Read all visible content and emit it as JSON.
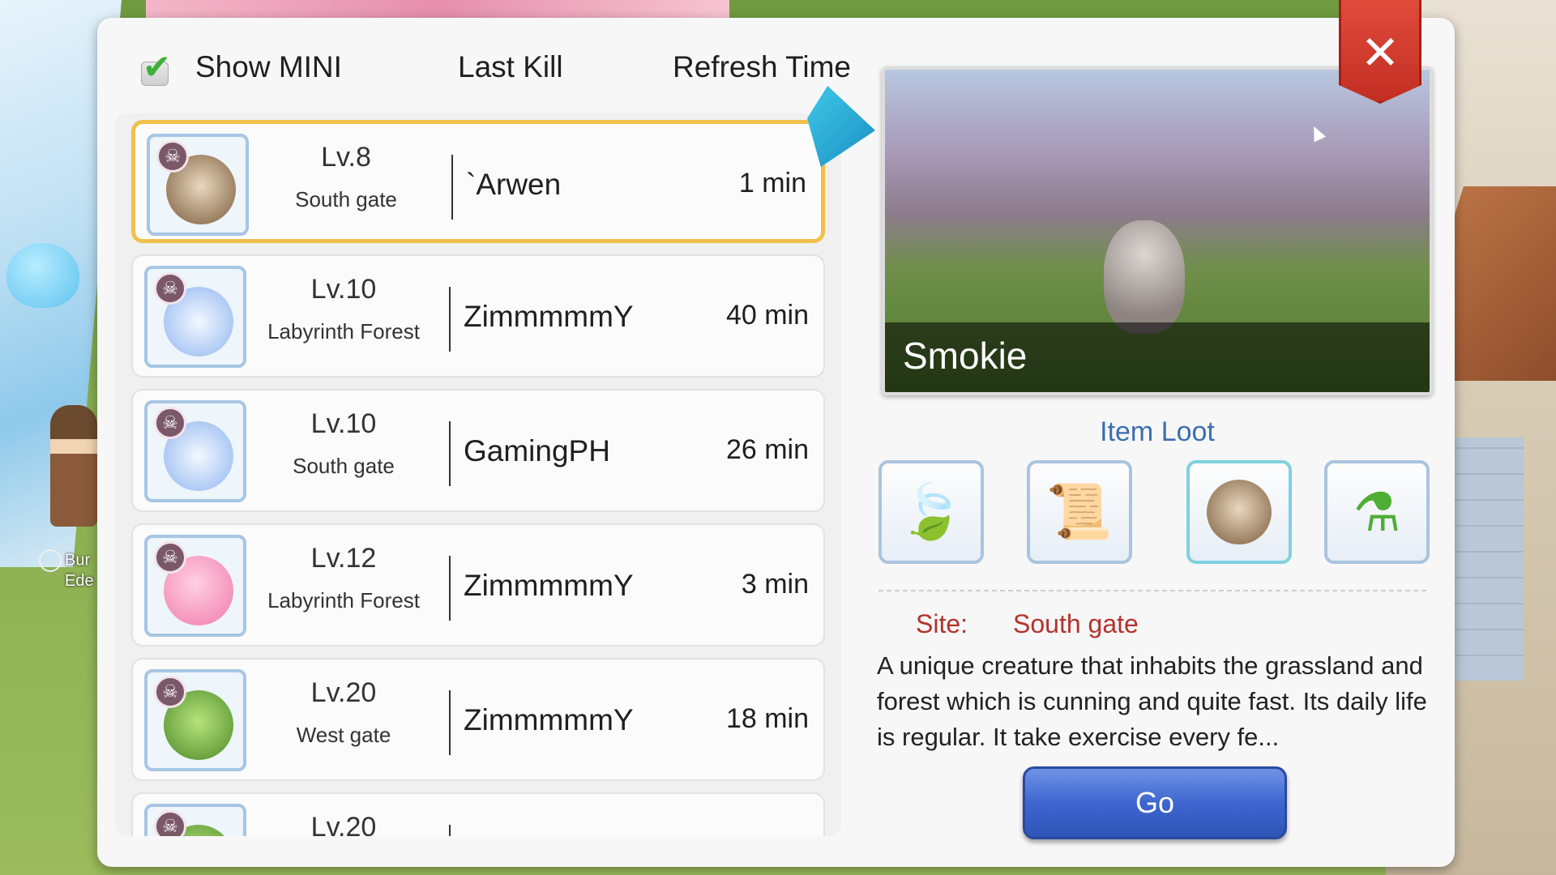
{
  "header": {
    "show_mini_label": "Show MINI",
    "show_mini_checked": true,
    "last_kill_label": "Last Kill",
    "refresh_time_label": "Refresh Time"
  },
  "rows": [
    {
      "level": "Lv.8",
      "site": "South gate",
      "last_kill": "`Arwen",
      "refresh": "1 min",
      "selected": true,
      "creature": "raccoon-icon"
    },
    {
      "level": "Lv.10",
      "site": "Labyrinth Forest",
      "last_kill": "ZimmmmmY",
      "refresh": "40 min",
      "selected": false,
      "creature": "lunatic-icon"
    },
    {
      "level": "Lv.10",
      "site": "South gate",
      "last_kill": "GamingPH",
      "refresh": "26 min",
      "selected": false,
      "creature": "lunatic-icon"
    },
    {
      "level": "Lv.12",
      "site": "Labyrinth Forest",
      "last_kill": "ZimmmmmY",
      "refresh": "3 min",
      "selected": false,
      "creature": "poring-icon"
    },
    {
      "level": "Lv.20",
      "site": "West gate",
      "last_kill": "ZimmmmmY",
      "refresh": "18 min",
      "selected": false,
      "creature": "rocker-icon"
    },
    {
      "level": "Lv.20",
      "site": "",
      "last_kill": "",
      "refresh": "",
      "selected": false,
      "creature": "rocker-icon"
    }
  ],
  "detail": {
    "monster_name": "Smokie",
    "item_loot_label": "Item Loot",
    "loot": [
      "leaf-icon",
      "scroll-icon",
      "raccoon-card-icon",
      "green-potion-icon"
    ],
    "site_label": "Site:",
    "site_value": "South gate",
    "description": "A unique creature that inhabits the grassland and forest which is cunning and quite fast. Its daily life is regular. It take exercise every fe...",
    "go_label": "Go"
  },
  "background": {
    "npc_label_line1": "Bur",
    "npc_label_line2": "Ede"
  },
  "colors": {
    "selected_border": "#f1c04c",
    "loot_title": "#3b6eb0",
    "site_text": "#b5322c",
    "go_button": "#3e66cf",
    "close_button": "#c22e22"
  }
}
